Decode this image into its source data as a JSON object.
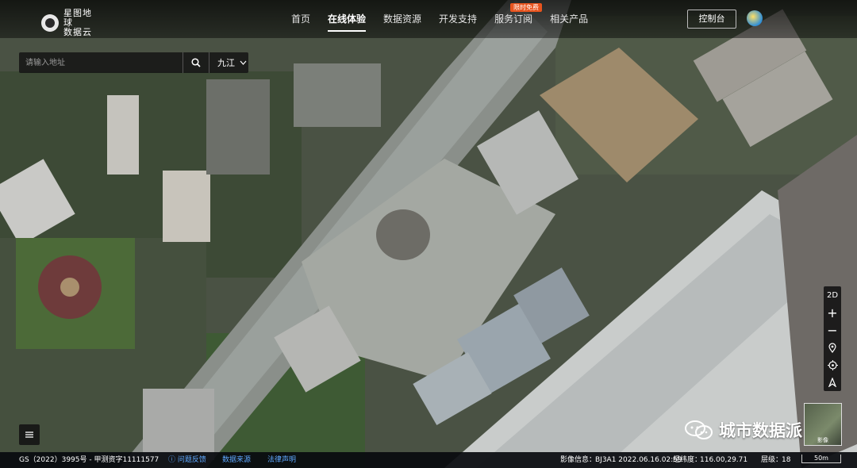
{
  "header": {
    "logo_line1": "星图地球",
    "logo_line2": "数据云",
    "nav": [
      "首页",
      "在线体验",
      "数据资源",
      "开发支持",
      "服务订阅",
      "相关产品"
    ],
    "active_nav": "在线体验",
    "badge": "限时免费",
    "console": "控制台"
  },
  "search": {
    "placeholder": "请输入地址",
    "city": "九江",
    "icon": "search-icon",
    "city_icon": "chevron-down-icon"
  },
  "map_controls": {
    "mode": "2D",
    "zoom_in": "+",
    "zoom_out": "−",
    "icons": [
      "location-pin-icon",
      "crosshair-icon",
      "compass-icon"
    ]
  },
  "layer_switch": {
    "label": "影像"
  },
  "watermark": "城市数据派",
  "footer": {
    "license": "GS（2022）3995号 - 甲测资字11111577",
    "feedback": "问题反馈",
    "source": "数据来源",
    "legal": "法律声明",
    "image_info": "影像信息：",
    "image_value": "BJ3A1 2022.06.16.02:59",
    "coords_label": "经纬度：",
    "coords": "116.00,29.71",
    "level_label": "层级：",
    "level": "18",
    "scale": "50m"
  },
  "colors": {
    "accent": "#5fa8ff",
    "badge": "#e8541e"
  }
}
